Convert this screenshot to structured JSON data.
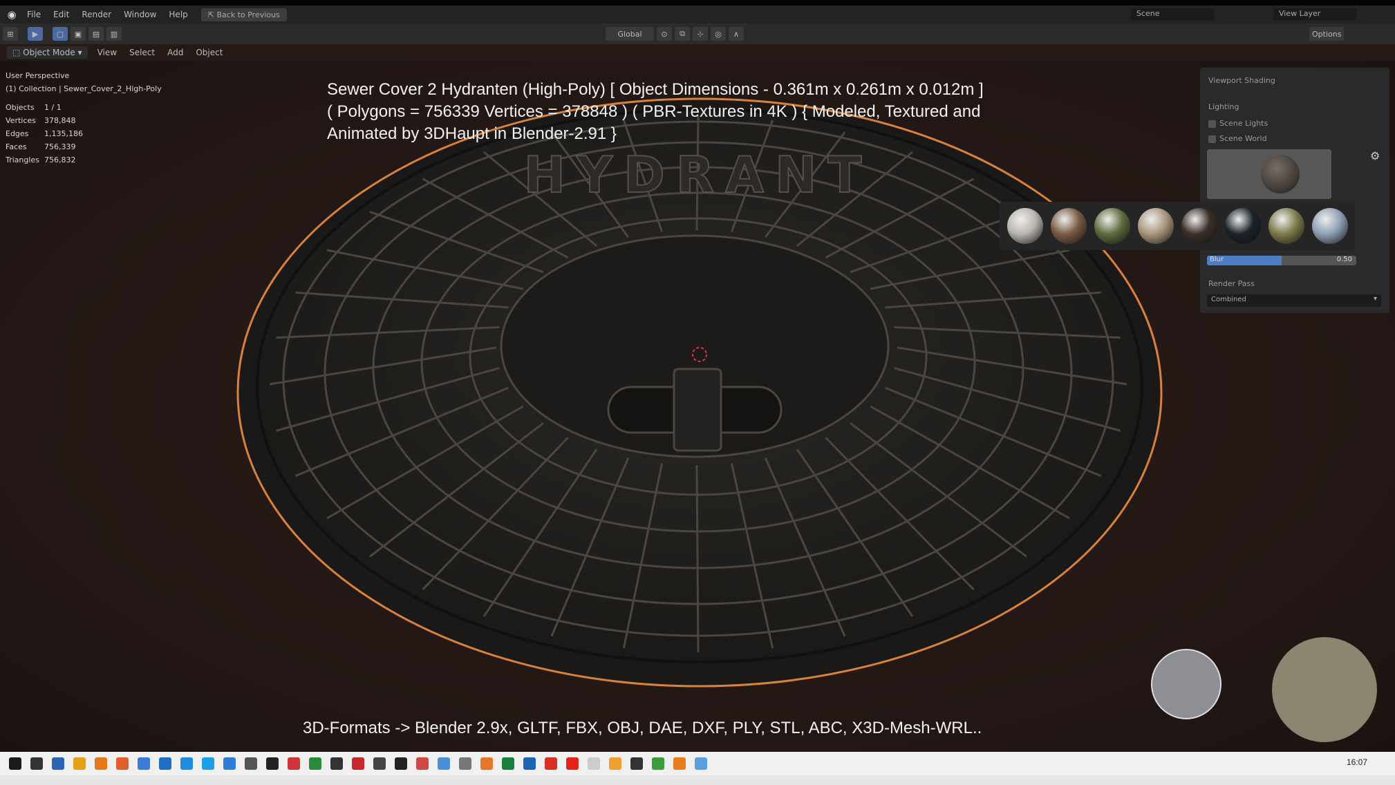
{
  "menubar": {
    "logo": "blender-logo",
    "items": [
      "File",
      "Edit",
      "Render",
      "Window",
      "Help"
    ],
    "back_button": "Back to Previous",
    "scene_label": "Scene",
    "view_layer_label": "View Layer"
  },
  "toolbar": {
    "transform_orientation": "Global",
    "options_label": "Options"
  },
  "header": {
    "mode": "Object Mode",
    "menus": [
      "View",
      "Select",
      "Add",
      "Object"
    ]
  },
  "viewport_info": {
    "view_name": "User Perspective",
    "collection": "(1) Collection | Sewer_Cover_2_High-Poly",
    "stats": [
      {
        "label": "Objects",
        "value": "1 / 1"
      },
      {
        "label": "Vertices",
        "value": "378,848"
      },
      {
        "label": "Edges",
        "value": "1,135,186"
      },
      {
        "label": "Faces",
        "value": "756,339"
      },
      {
        "label": "Triangles",
        "value": "756,832"
      }
    ]
  },
  "overlay": {
    "title_line1": "Sewer Cover 2 Hydranten (High-Poly) [ Object Dimensions -  0.361m x 0.261m x 0.012m ]",
    "title_line2": "( Polygons = 756339 Vertices = 378848 ) ( PBR-Textures in 4K ) { Modeled, Textured and",
    "title_line3": "Animated by 3DHaupt in Blender-2.91 }",
    "formats": "3D-Formats -> Blender 2.9x, GLTF, FBX, OBJ, DAE, DXF, PLY, STL, ABC, X3D-Mesh-WRL..",
    "cover_text": "HYDRANT"
  },
  "shading_panel": {
    "title": "Viewport Shading",
    "lighting": "Lighting",
    "scene_lights": "Scene Lights",
    "scene_world": "Scene World",
    "blur_label": "Blur",
    "blur_value": "0.50",
    "blur_fraction": 0.5,
    "render_pass_label": "Render Pass",
    "render_pass_value": "Combined"
  },
  "hdri_options": [
    "#b9b4ad",
    "#7a5a44",
    "#5e6b3e",
    "#a8957c",
    "#3b2f28",
    "#1a222a",
    "#7d7a4a",
    "#8e9fb4"
  ],
  "taskbar": {
    "clock": "16:07",
    "icon_colors": [
      "#1a1a1a",
      "#333",
      "#2d62b5",
      "#e3a21a",
      "#e7771b",
      "#e15f2b",
      "#3a7bd5",
      "#1c6fc2",
      "#1d8ce0",
      "#1e9fe8",
      "#2d7cd6",
      "#555",
      "#222",
      "#d13438",
      "#2a8a3c",
      "#333",
      "#c9272f",
      "#444",
      "#222",
      "#d04747",
      "#4a90d9",
      "#777",
      "#e8762a",
      "#1a7f3c",
      "#1e64b4",
      "#d93025",
      "#e2231a",
      "#ccc",
      "#f0a030",
      "#333",
      "#3b9c3b",
      "#e87d1e",
      "#5aa0e0"
    ]
  }
}
